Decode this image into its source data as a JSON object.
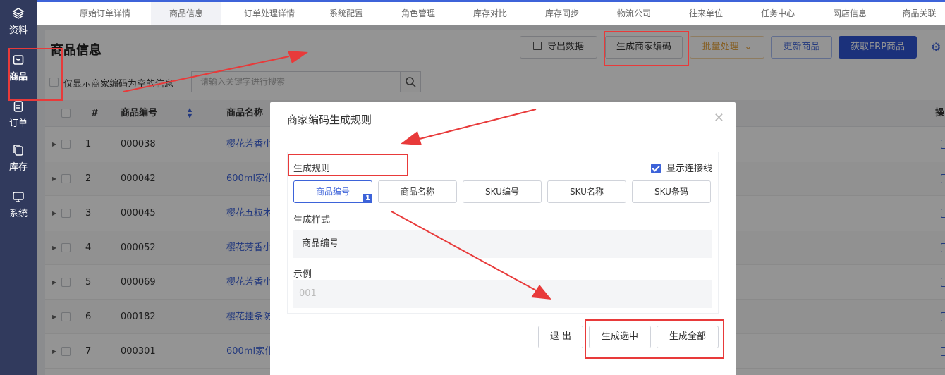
{
  "sidebar": {
    "items": [
      {
        "label": "资料",
        "icon": "layers-icon"
      },
      {
        "label": "商品",
        "icon": "bag-icon"
      },
      {
        "label": "订单",
        "icon": "document-icon"
      },
      {
        "label": "库存",
        "icon": "copy-icon"
      },
      {
        "label": "系统",
        "icon": "monitor-icon"
      }
    ]
  },
  "tabs": [
    "原始订单详情",
    "商品信息",
    "订单处理详情",
    "系统配置",
    "角色管理",
    "库存对比",
    "库存同步",
    "物流公司",
    "往来单位",
    "任务中心",
    "网店信息",
    "商品关联"
  ],
  "active_tab": "商品信息",
  "page": {
    "title": "商品信息",
    "toolbar": {
      "export": "导出数据",
      "generate_code": "生成商家编码",
      "batch": "批量处理",
      "update": "更新商品",
      "fetch_erp": "获取ERP商品"
    },
    "filter_label": "仅显示商家编码为空的信息",
    "search_placeholder": "请输入关键字进行搜索",
    "table": {
      "headers": [
        "#",
        "商品编号",
        "商品名称"
      ],
      "partial_header": "操",
      "rows": [
        {
          "index": "1",
          "code": "000038",
          "name": "樱花芳香小"
        },
        {
          "index": "2",
          "code": "000042",
          "name": "600ml家仆"
        },
        {
          "index": "3",
          "code": "000045",
          "name": "樱花五粒木"
        },
        {
          "index": "4",
          "code": "000052",
          "name": "樱花芳香小"
        },
        {
          "index": "5",
          "code": "000069",
          "name": "樱花芳香小"
        },
        {
          "index": "6",
          "code": "000182",
          "name": "樱花挂条防"
        },
        {
          "index": "7",
          "code": "000301",
          "name": "600ml家仆"
        }
      ]
    }
  },
  "modal": {
    "title": "商家编码生成规则",
    "rule_label": "生成规则",
    "show_lines_label": "显示连接线",
    "rule_buttons": [
      "商品编号",
      "商品名称",
      "SKU编号",
      "SKU名称",
      "SKU条码"
    ],
    "selected_badge": "1",
    "style_label": "生成样式",
    "style_value": "商品编号",
    "example_label": "示例",
    "example_value": "001",
    "buttons": {
      "exit": "退 出",
      "generate_selected": "生成选中",
      "generate_all": "生成全部"
    }
  },
  "colors": {
    "sidebar_bg": "#313a5d",
    "primary": "#2f55d4",
    "annotation": "#e83a3a"
  }
}
